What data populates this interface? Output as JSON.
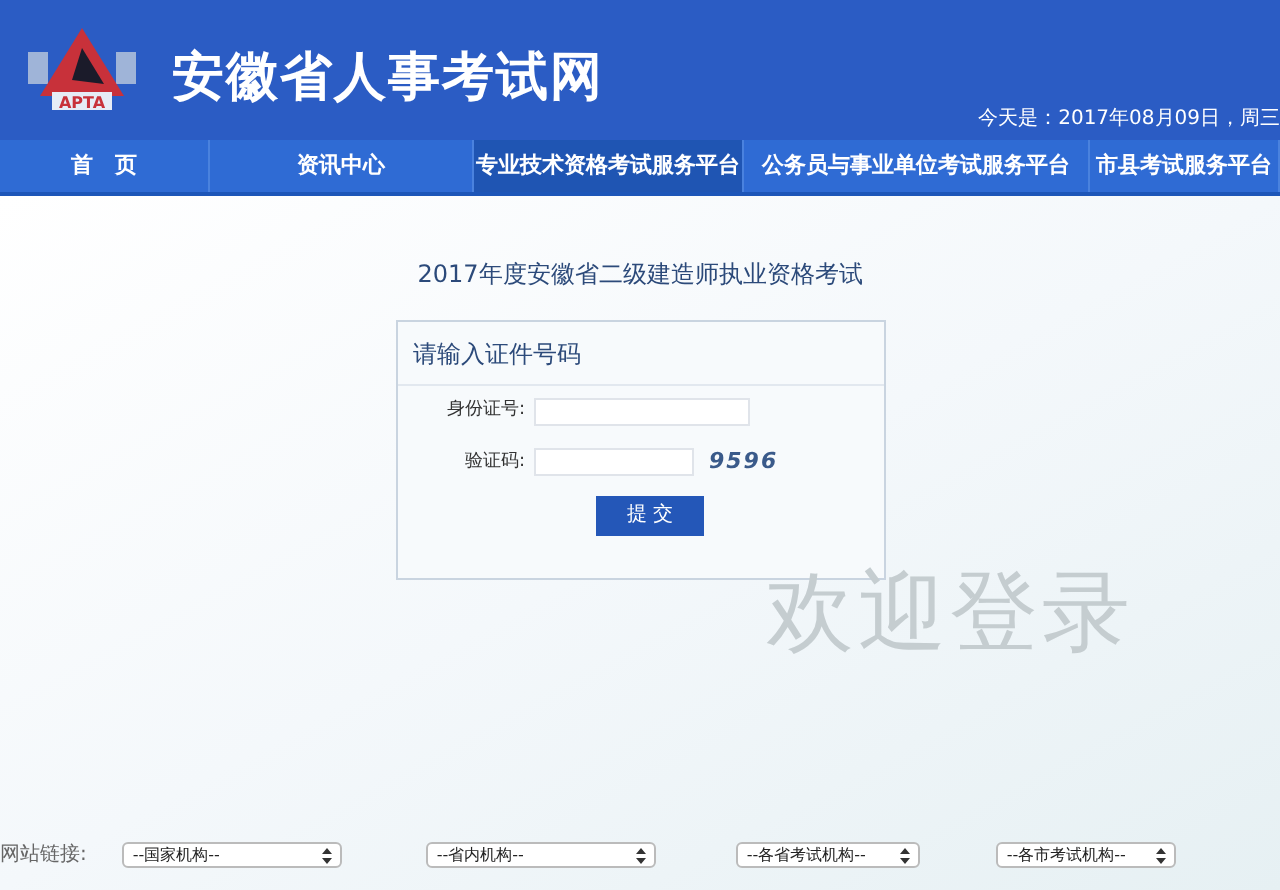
{
  "header": {
    "logo_text": "APTA",
    "site_title": "安徽省人事考试网",
    "date": "今天是：2017年08月09日，周三"
  },
  "nav": [
    {
      "label": "首　页",
      "selected": false
    },
    {
      "label": "资讯中心",
      "selected": false
    },
    {
      "label": "专业技术资格考试服务平台",
      "selected": true
    },
    {
      "label": "公务员与事业单位考试服务平台",
      "selected": false
    },
    {
      "label": "市县考试服务平台",
      "selected": false
    }
  ],
  "exam_title": "2017年度安徽省二级建造师执业资格考试",
  "form": {
    "heading": "请输入证件号码",
    "id_label": "身份证号:",
    "captcha_label": "验证码:",
    "captcha": "9596",
    "submit": "提 交"
  },
  "welcome": "欢迎登录",
  "footer": {
    "label": "网站链接:",
    "selects": [
      "--国家机构--",
      "--省内机构--",
      "--各省考试机构--",
      "--各市考试机构--"
    ]
  }
}
